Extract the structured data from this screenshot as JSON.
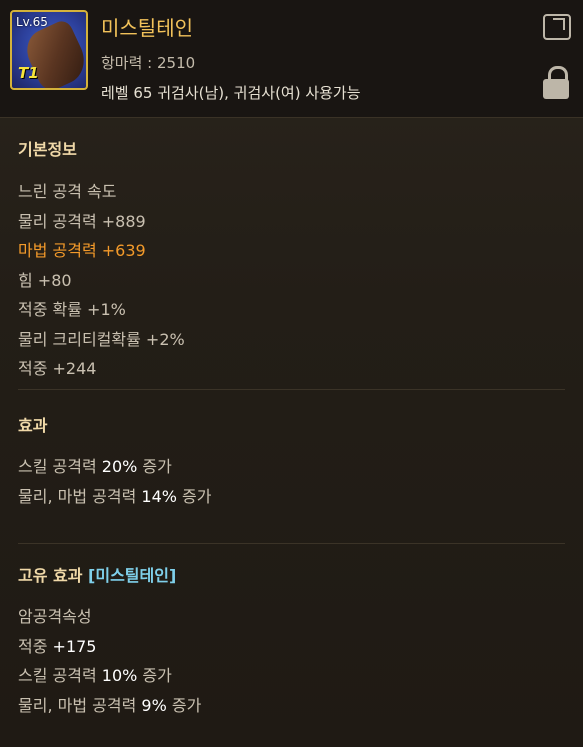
{
  "item": {
    "level": "Lv.65",
    "tier": "T1",
    "name": "미스틸테인",
    "magic_resist": "항마력 : 2510",
    "requirement": "레벨 65 귀검사(남), 귀검사(여) 사용가능"
  },
  "basic_info": {
    "title": "기본정보",
    "lines": [
      "느린 공격 속도",
      "물리 공격력 +889",
      "마법 공격력 +639",
      "힘 +80",
      "적중 확률 +1%",
      "물리 크리티컬확률 +2%",
      "적중 +244"
    ]
  },
  "effects": {
    "title": "효과",
    "line1_prefix": "스킬 공격력 ",
    "line1_value": "20%",
    "line1_suffix": " 증가",
    "line2_prefix": "물리, 마법 공격력 ",
    "line2_value": "14%",
    "line2_suffix": " 증가"
  },
  "unique": {
    "title_prefix": "고유 효과 ",
    "title_name": "[미스틸테인]",
    "line1": "암공격속성",
    "line2_prefix": "적중 ",
    "line2_value": "+175",
    "line3_prefix": "스킬 공격력 ",
    "line3_value": "10%",
    "line3_suffix": " 증가",
    "line4_prefix": "물리, 마법 공격력 ",
    "line4_value": "9%",
    "line4_suffix": " 증가"
  },
  "colors": {
    "name": "#f2c25a",
    "magic_attack": "#f39a2a",
    "set_name": "#7fd0ea",
    "frame": "#d4b23a"
  },
  "icons": [
    "share-icon",
    "lock-icon",
    "weapon-icon"
  ]
}
